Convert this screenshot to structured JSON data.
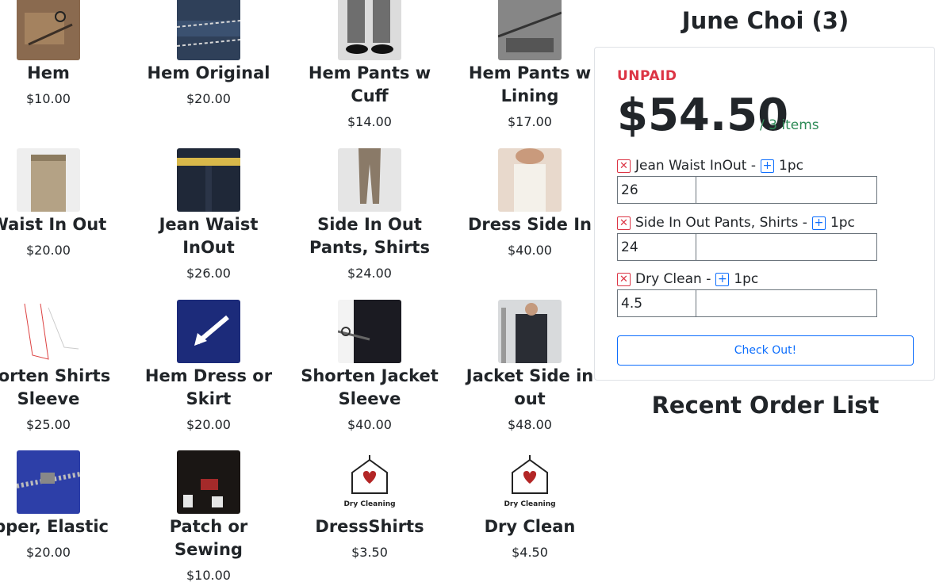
{
  "customer": {
    "title": "June Choi (3)"
  },
  "order": {
    "status": "UNPAID",
    "total": "$54.50",
    "items_count": "/ 3 items",
    "lines": [
      {
        "name": "Jean Waist InOut -",
        "qty_label": "1pc",
        "price_value": "26"
      },
      {
        "name": "Side In Out Pants, Shirts -",
        "qty_label": "1pc",
        "price_value": "24"
      },
      {
        "name": "Dry Clean -",
        "qty_label": "1pc",
        "price_value": "4.5"
      }
    ],
    "checkout_label": "Check Out!"
  },
  "recent": {
    "title": "Recent Order List"
  },
  "products": [
    [
      {
        "name_lines": [
          "Hem"
        ],
        "price": "$10.00",
        "icon": "hem-photo-icon"
      },
      {
        "name_lines": [
          "Waist In Out"
        ],
        "price": "$20.00",
        "icon": "waist-in-out-photo-icon"
      },
      {
        "name_lines": [
          "horten Shirts",
          "Sleeve"
        ],
        "price": "$25.00",
        "icon": "shirt-sleeve-sketch-icon"
      },
      {
        "name_lines": [
          "ipper, Elastic"
        ],
        "price": "$20.00",
        "icon": "zipper-photo-icon"
      }
    ],
    [
      {
        "name_lines": [
          "Hem Original"
        ],
        "price": "$20.00",
        "icon": "jean-hem-photo-icon"
      },
      {
        "name_lines": [
          "Jean Waist",
          "InOut"
        ],
        "price": "$26.00",
        "icon": "jean-waist-photo-icon"
      },
      {
        "name_lines": [
          "Hem Dress or",
          "Skirt"
        ],
        "price": "$20.00",
        "icon": "dress-hem-photo-icon"
      },
      {
        "name_lines": [
          "Patch or",
          "Sewing"
        ],
        "price": "$10.00",
        "icon": "patch-photo-icon"
      }
    ],
    [
      {
        "name_lines": [
          "Hem Pants w",
          "Cuff"
        ],
        "price": "$14.00",
        "icon": "pants-cuff-photo-icon"
      },
      {
        "name_lines": [
          "Side In Out",
          "Pants, Shirts"
        ],
        "price": "$24.00",
        "icon": "pants-side-photo-icon"
      },
      {
        "name_lines": [
          "Shorten Jacket",
          "Sleeve"
        ],
        "price": "$40.00",
        "icon": "jacket-sleeve-photo-icon"
      },
      {
        "name_lines": [
          "DressShirts"
        ],
        "price": "$3.50",
        "icon": "dry-cleaning-logo-icon",
        "logo_text": "Dry Cleaning"
      }
    ],
    [
      {
        "name_lines": [
          "Hem Pants w",
          "Lining"
        ],
        "price": "$17.00",
        "icon": "pants-lining-photo-icon"
      },
      {
        "name_lines": [
          "Dress Side In"
        ],
        "price": "$40.00",
        "icon": "dress-side-photo-icon"
      },
      {
        "name_lines": [
          "Jacket Side in",
          "out"
        ],
        "price": "$48.00",
        "icon": "jacket-side-photo-icon"
      },
      {
        "name_lines": [
          "Dry Clean"
        ],
        "price": "$4.50",
        "icon": "dry-cleaning-logo-icon",
        "logo_text": "Dry Cleaning"
      }
    ]
  ],
  "colors": {
    "unpaid": "#dc3545",
    "accent": "#0d6efd",
    "items_count": "#2e8b57"
  }
}
